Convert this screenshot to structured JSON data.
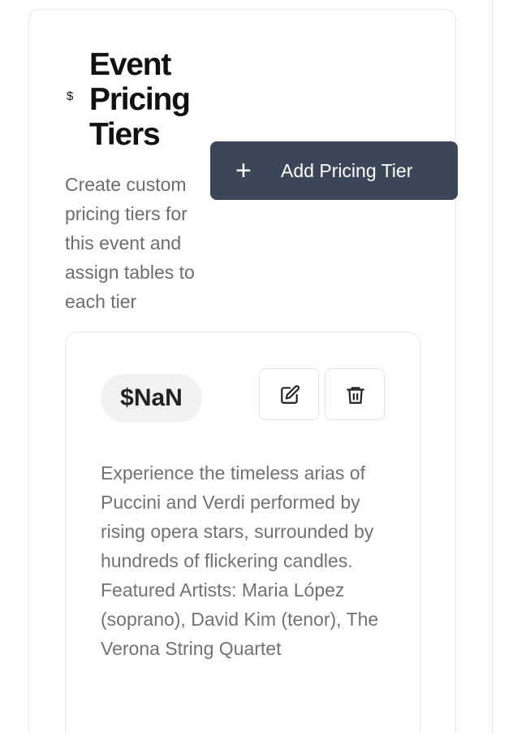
{
  "pricing_section": {
    "currency_symbol": "$",
    "title": "Event Pricing Tiers",
    "description": "Create custom pricing tiers for this event and assign tables to each tier",
    "add_button": {
      "icon": "plus-icon",
      "label": "Add Pricing Tier"
    },
    "tiers": [
      {
        "price": "$NaN",
        "actions": [
          {
            "name": "edit",
            "icon": "edit-icon"
          },
          {
            "name": "delete",
            "icon": "trash-icon"
          }
        ],
        "description": "Experience the timeless arias of Puccini and Verdi performed by rising opera stars, surrounded by hundreds of flickering candles. Featured Artists: Maria López (soprano), David Kim (tenor), The Verona String Quartet"
      }
    ]
  },
  "colors": {
    "primary_button": "#3b4658",
    "muted_text": "#6d6d6d",
    "badge_background": "#f2f2f2"
  }
}
